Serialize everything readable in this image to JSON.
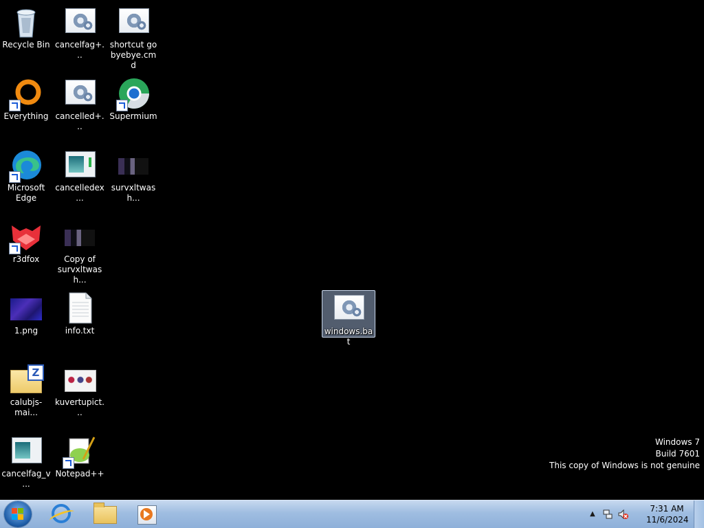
{
  "desktop": {
    "icons": {
      "recycle_bin": "Recycle Bin",
      "cancelfag": "cancelfag+...",
      "shortcut_go": "shortcut go byebye.cmd",
      "everything": "Everything",
      "cancelled": "cancelled+...",
      "supermium": "Supermium",
      "edge": "Microsoft Edge",
      "cancelledex": "cancelledex...",
      "survxltwash": "survxltwash...",
      "r3dfox": "r3dfox",
      "copy_survxl": "Copy of survxltwash...",
      "png1": "1.png",
      "info": "info.txt",
      "calubjs": "calubjs-mai...",
      "kuvertupict": "kuvertupict...",
      "cancelfag_v": "cancelfag_v...",
      "notepadpp": "Notepad++",
      "windows_bat": "windows.bat"
    }
  },
  "watermark": {
    "line1": "Windows 7",
    "line2": "Build 7601",
    "line3": "This copy of Windows is not genuine"
  },
  "taskbar": {
    "pinned": [
      "internet-explorer-icon",
      "windows-explorer-icon",
      "media-player-icon"
    ],
    "tray_arrow": "▲",
    "clock_time": "7:31 AM",
    "clock_date": "11/6/2024"
  },
  "colors": {
    "desktop_bg": "#000000",
    "taskbar": "#9fbde1"
  }
}
